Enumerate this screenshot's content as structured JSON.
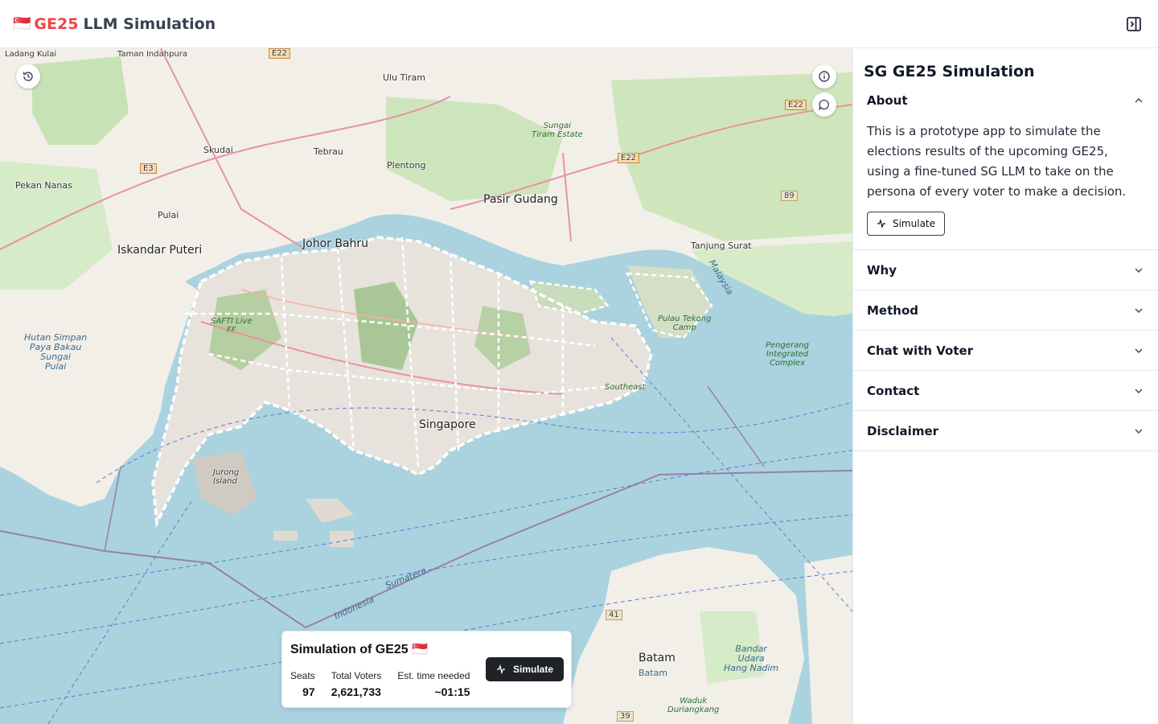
{
  "header": {
    "flag": "🇸🇬",
    "brand_accent": "GE25",
    "brand_title": "LLM Simulation",
    "toggle_icon": "panel-right-icon"
  },
  "map": {
    "labels": {
      "johor_bahru": "Johor Bahru",
      "iskandar_puteri": "Iskandar Puteri",
      "pasir_gudang": "Pasir Gudang",
      "singapore": "Singapore",
      "batam": "Batam",
      "batam_small": "Batam",
      "ulu_tiram": "Ulu Tiram",
      "tebrau": "Tebrau",
      "plentong": "Plentong",
      "skudai": "Skudai",
      "pulai": "Pulai",
      "pekan_nanas": "Pekan Nanas",
      "tanjung_surat": "Tanjung Surat",
      "jurong_island": "Jurong\nIsland",
      "pulau_tekong": "Pulau Tekong\nCamp",
      "sungai_tiram": "Sungai\nTiram Estate",
      "hutan_simpan": "Hutan Simpan\nPaya Bakau\nSungai\nPulai",
      "pengerang": "Pengerang\nIntegrated\nComplex",
      "bandar_udara": "Bandar\nUdara\nHang Nadim",
      "waduk": "Waduk\nDuriangkang",
      "ladang": "Ladang\nKulai",
      "taman": "Taman\nIndahpura",
      "indonesia": "Indonesia",
      "sumatera": "Sumatera",
      "malaysia": "Malaysia",
      "safti": "SAFTI Live\nFF",
      "southeast": "Southeast",
      "e22_a": "E22",
      "e22_b": "E22",
      "e22_c": "E22",
      "e3": "E3",
      "r89": "89",
      "r41": "41",
      "r39": "39"
    },
    "history_icon": "history-icon",
    "info_icon": "info-icon",
    "chat_icon": "message-circle-icon"
  },
  "sim_card": {
    "title": "Simulation of GE25 🇸🇬",
    "seats_label": "Seats",
    "seats_value": "97",
    "voters_label": "Total Voters",
    "voters_value": "2,621,733",
    "time_label": "Est. time needed",
    "time_value": "~01:15",
    "button_label": "Simulate",
    "button_icon": "activity-icon"
  },
  "sidebar": {
    "title": "SG GE25 Simulation",
    "sections": [
      {
        "label": "About",
        "expanded": true,
        "body": "This is a prototype app to simulate the elections results of the upcoming GE25, using a fine-tuned SG LLM to take on the persona of every voter to make a decision.",
        "button_label": "Simulate"
      },
      {
        "label": "Why",
        "expanded": false
      },
      {
        "label": "Method",
        "expanded": false
      },
      {
        "label": "Chat with Voter",
        "expanded": false
      },
      {
        "label": "Contact",
        "expanded": false
      },
      {
        "label": "Disclaimer",
        "expanded": false
      }
    ]
  },
  "colors": {
    "accent": "#ef4444",
    "water": "#aad3df",
    "land": "#f2efe9",
    "dark_button": "#1f2328"
  }
}
